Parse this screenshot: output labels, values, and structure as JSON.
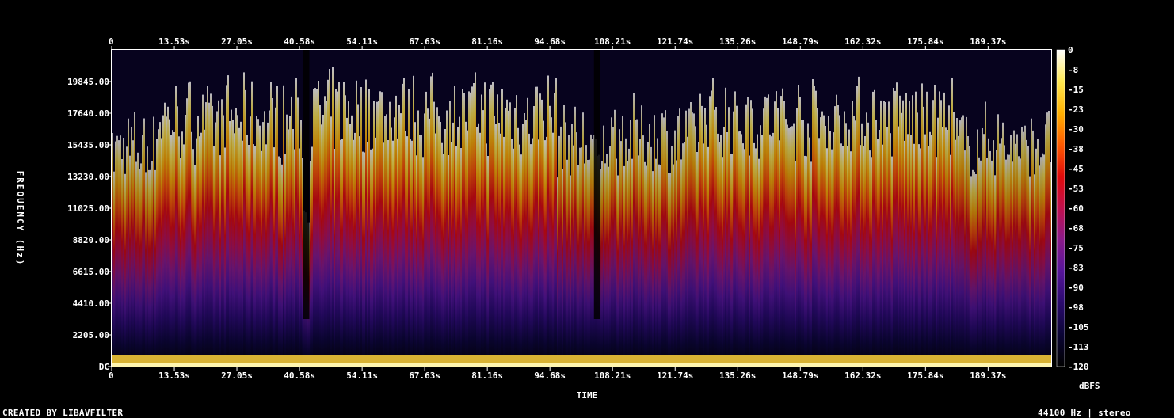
{
  "chart_data": {
    "type": "heatmap",
    "title": "",
    "xlabel": "TIME",
    "ylabel": "FREQUENCY (Hz)",
    "x_ticks": [
      "0",
      "13.53s",
      "27.05s",
      "40.58s",
      "54.11s",
      "67.63s",
      "81.16s",
      "94.68s",
      "108.21s",
      "121.74s",
      "135.26s",
      "148.79s",
      "162.32s",
      "175.84s",
      "189.37s"
    ],
    "x_tick_seconds": [
      0,
      13.53,
      27.05,
      40.58,
      54.11,
      67.63,
      81.16,
      94.68,
      108.21,
      121.74,
      135.26,
      148.79,
      162.32,
      175.84,
      189.37
    ],
    "x_range_seconds": [
      0,
      203.0
    ],
    "y_ticks": [
      "DC",
      "2205.00",
      "4410.00",
      "6615.00",
      "8820.00",
      "11025.00",
      "13230.00",
      "15435.00",
      "17640.00",
      "19845.00"
    ],
    "y_tick_hz": [
      0,
      2205,
      4410,
      6615,
      8820,
      11025,
      13230,
      15435,
      17640,
      19845
    ],
    "y_range_hz": [
      0,
      22050
    ],
    "colorbar_label": "dBFS",
    "colorbar_ticks": [
      "0",
      "-8",
      "-15",
      "-23",
      "-30",
      "-38",
      "-45",
      "-53",
      "-60",
      "-68",
      "-75",
      "-83",
      "-90",
      "-98",
      "-105",
      "-113",
      "-120"
    ],
    "colorbar_range_db": [
      -120,
      0
    ],
    "colormap": [
      "#000000",
      "#0b0535",
      "#2a0a6e",
      "#56159a",
      "#8a1a8a",
      "#c0104e",
      "#e00a0a",
      "#ff5a00",
      "#ffb000",
      "#ffe850",
      "#ffffff"
    ],
    "quiet_segments_seconds": [
      [
        41.3,
        42.7
      ],
      [
        104.2,
        105.5
      ],
      [
        203.0,
        203.0
      ]
    ],
    "sections": [
      {
        "start_s": 0,
        "end_s": 9.5,
        "level_db": -88
      },
      {
        "start_s": 9.5,
        "end_s": 41.3,
        "level_db": -75
      },
      {
        "start_s": 41.3,
        "end_s": 42.7,
        "level_db": -118
      },
      {
        "start_s": 42.7,
        "end_s": 96.0,
        "level_db": -72
      },
      {
        "start_s": 96.0,
        "end_s": 104.2,
        "level_db": -85
      },
      {
        "start_s": 104.2,
        "end_s": 105.5,
        "level_db": -100
      },
      {
        "start_s": 105.5,
        "end_s": 127.0,
        "level_db": -83
      },
      {
        "start_s": 127.0,
        "end_s": 182.0,
        "level_db": -74
      },
      {
        "start_s": 182.0,
        "end_s": 203.0,
        "level_db": -86
      }
    ]
  },
  "footer": {
    "credit": "CREATED BY LIBAVFILTER",
    "info": "44100 Hz | stereo"
  }
}
